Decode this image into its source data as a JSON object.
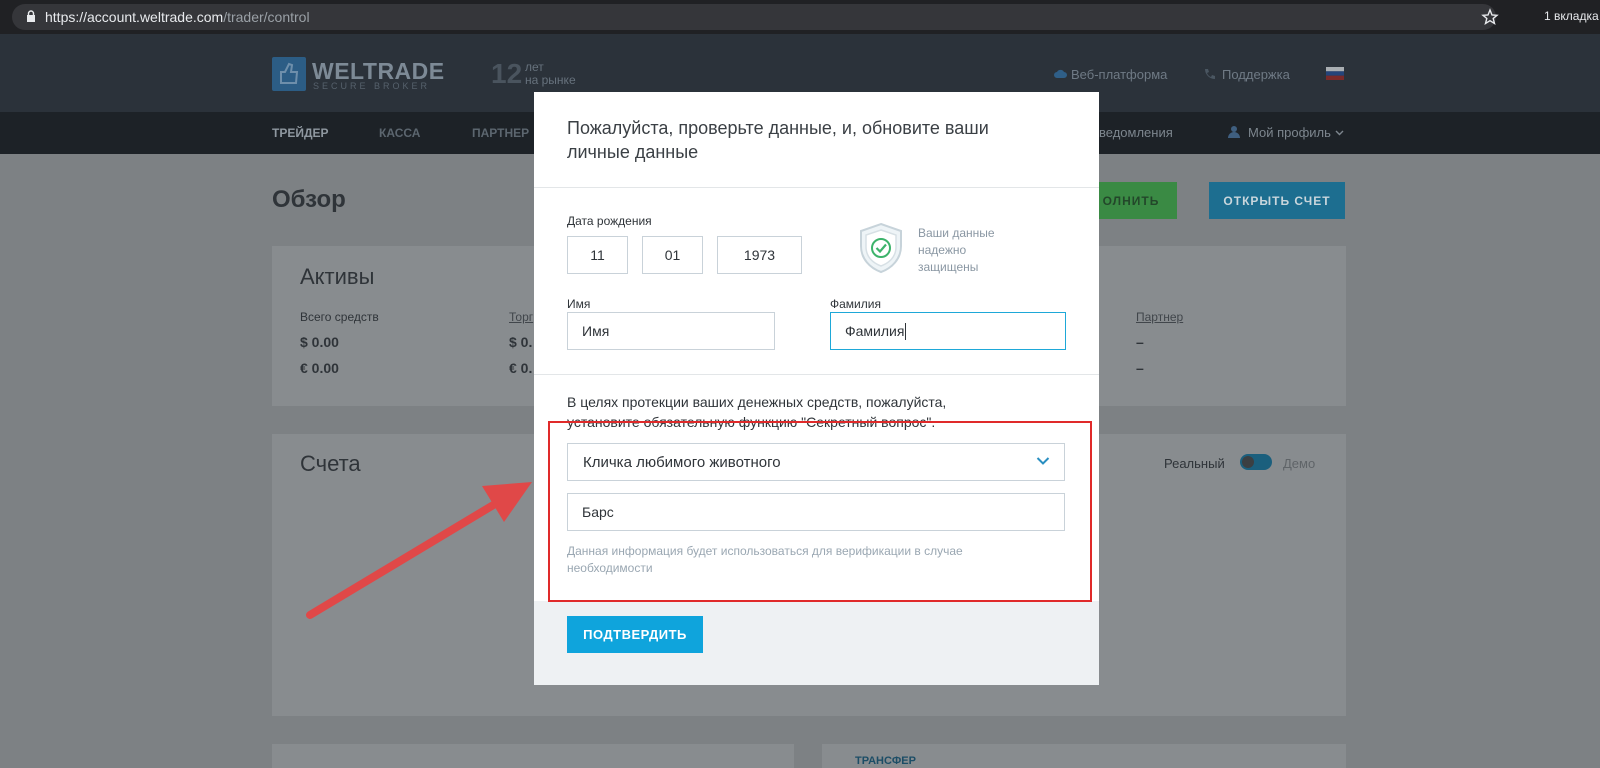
{
  "browser": {
    "url_host": "https://account.weltrade.com",
    "url_path": "/trader/control",
    "tabs_count": "1 вкладка"
  },
  "header": {
    "logo_name": "WELTRADE",
    "logo_sub": "SECURE BROKER",
    "years_num": "12",
    "years_line1": "лет",
    "years_line2": "на рынке",
    "web_platform": "Веб-платформа",
    "support": "Поддержка"
  },
  "nav": {
    "items": [
      "ТРЕЙДЕР",
      "КАССА",
      "ПАРТНЕР"
    ],
    "notifications": "ведомления",
    "profile": "Мой профиль"
  },
  "page": {
    "title": "Обзор",
    "deposit_button": "ОЛНИТЬ",
    "open_account_button": "ОТКРЫТЬ СЧЕТ",
    "assets": {
      "title": "Активы",
      "total_label": "Всего средств",
      "usd": "$ 0.00",
      "eur": "€ 0.00",
      "trade_link": "Торг",
      "trade_usd": "$ 0.",
      "trade_eur": "€ 0.",
      "partner_link": "Партнер",
      "partner_v1": "–",
      "partner_v2": "–"
    },
    "accounts": {
      "title": "Счета",
      "real": "Реальный",
      "demo": "Демо"
    },
    "transfer": "ТРАНСФЕР"
  },
  "modal": {
    "title": "Пожалуйста, проверьте данные, и, обновите ваши личные данные",
    "dob_label": "Дата рождения",
    "dob_day": "11",
    "dob_month": "01",
    "dob_year": "1973",
    "secure_text": "Ваши данные надежно защищены",
    "first_name_label": "Имя",
    "first_name_value": "Имя",
    "last_name_label": "Фамилия",
    "last_name_value": "Фамилия",
    "protect_text": "В целях протекции ваших денежных средств, пожалуйста, установите обязательную функцию \"Секретный вопрос\".",
    "question_selected": "Кличка любимого животного",
    "answer_value": "Барс",
    "hint_text": "Данная информация будет использоваться для верификации в случае необходимости",
    "confirm_button": "ПОДТВЕРДИТЬ"
  },
  "colors": {
    "accent": "#0fa4dc",
    "annotation": "#e02a2a",
    "overlay": "#7d8184"
  }
}
